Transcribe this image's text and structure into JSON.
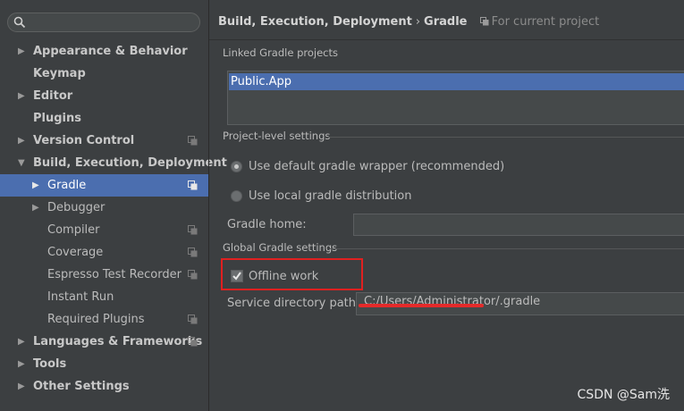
{
  "search": {
    "placeholder": ""
  },
  "sidebar": {
    "items": [
      {
        "label": "Appearance & Behavior",
        "arrow": "▶",
        "indent": 0,
        "bold": true,
        "copy": false,
        "selected": false
      },
      {
        "label": "Keymap",
        "arrow": "",
        "indent": 0,
        "bold": true,
        "copy": false,
        "selected": false
      },
      {
        "label": "Editor",
        "arrow": "▶",
        "indent": 0,
        "bold": true,
        "copy": false,
        "selected": false
      },
      {
        "label": "Plugins",
        "arrow": "",
        "indent": 0,
        "bold": true,
        "copy": false,
        "selected": false
      },
      {
        "label": "Version Control",
        "arrow": "▶",
        "indent": 0,
        "bold": true,
        "copy": true,
        "selected": false
      },
      {
        "label": "Build, Execution, Deployment",
        "arrow": "▼",
        "indent": 0,
        "bold": true,
        "copy": false,
        "selected": false
      },
      {
        "label": "Gradle",
        "arrow": "▶",
        "indent": 1,
        "bold": false,
        "copy": true,
        "selected": true
      },
      {
        "label": "Debugger",
        "arrow": "▶",
        "indent": 1,
        "bold": false,
        "copy": false,
        "selected": false
      },
      {
        "label": "Compiler",
        "arrow": "",
        "indent": 1,
        "bold": false,
        "copy": true,
        "selected": false
      },
      {
        "label": "Coverage",
        "arrow": "",
        "indent": 1,
        "bold": false,
        "copy": true,
        "selected": false
      },
      {
        "label": "Espresso Test Recorder",
        "arrow": "",
        "indent": 1,
        "bold": false,
        "copy": true,
        "selected": false
      },
      {
        "label": "Instant Run",
        "arrow": "",
        "indent": 1,
        "bold": false,
        "copy": false,
        "selected": false
      },
      {
        "label": "Required Plugins",
        "arrow": "",
        "indent": 1,
        "bold": false,
        "copy": true,
        "selected": false
      },
      {
        "label": "Languages & Frameworks",
        "arrow": "▶",
        "indent": 0,
        "bold": true,
        "copy": true,
        "selected": false
      },
      {
        "label": "Tools",
        "arrow": "▶",
        "indent": 0,
        "bold": true,
        "copy": false,
        "selected": false
      },
      {
        "label": "Other Settings",
        "arrow": "▶",
        "indent": 0,
        "bold": true,
        "copy": false,
        "selected": false
      }
    ]
  },
  "header": {
    "crumb1": "Build, Execution, Deployment",
    "separator": "›",
    "crumb2": "Gradle",
    "scope": "For current project"
  },
  "linked": {
    "title": "Linked Gradle projects",
    "projects": [
      "Public.App"
    ]
  },
  "project_level": {
    "title": "Project-level settings",
    "option_wrapper": "Use default gradle wrapper (recommended)",
    "option_local": "Use local gradle distribution",
    "gradle_home_label": "Gradle home:",
    "gradle_home_value": ""
  },
  "global": {
    "title": "Global Gradle settings",
    "offline_label": "Offline work",
    "offline_checked": true,
    "service_dir_label": "Service directory path:",
    "service_dir_value": "C:/Users/Administrator/.gradle"
  },
  "watermark": "CSDN @Sam洗",
  "colors": {
    "selection": "#4b6eaf",
    "highlight": "#e02020",
    "background": "#3c3f41"
  }
}
